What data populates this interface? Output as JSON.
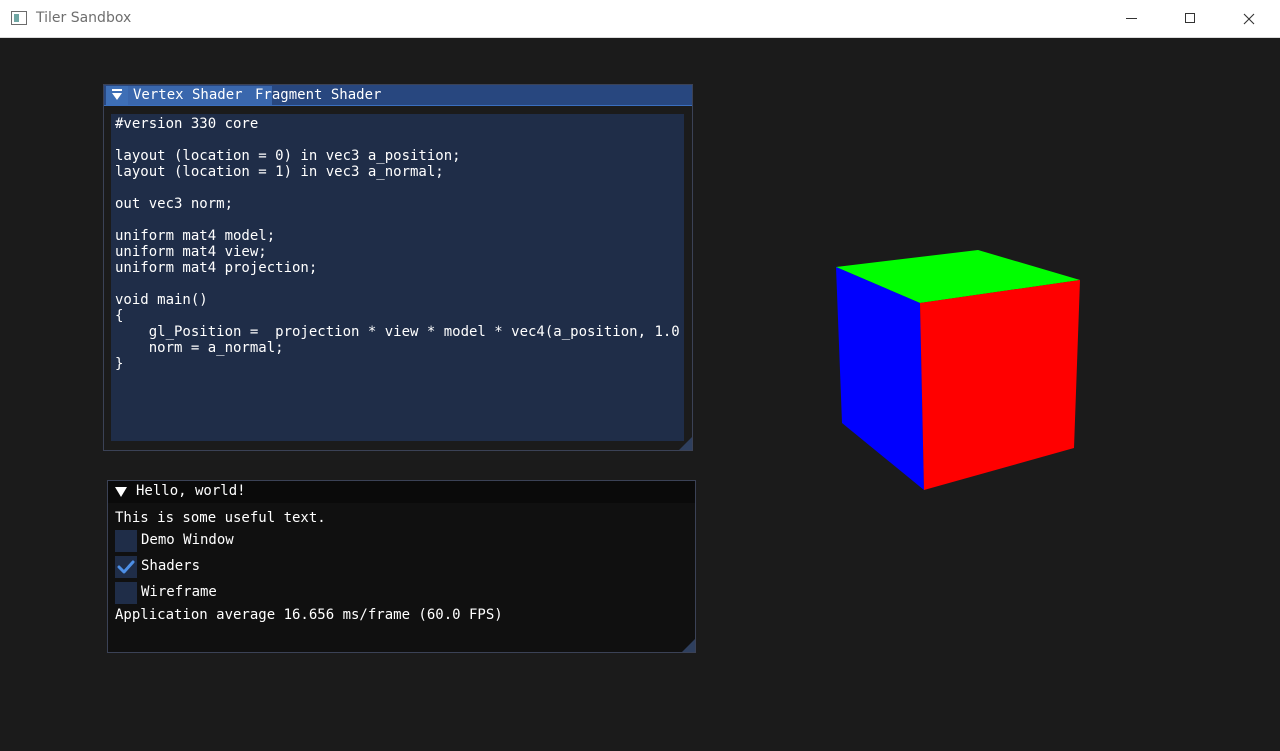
{
  "window": {
    "title": "Tiler Sandbox"
  },
  "shader_editor": {
    "tabs": [
      {
        "label": "Vertex Shader",
        "active": true
      },
      {
        "label": "Fragment Shader",
        "active": false
      }
    ],
    "code": "#version 330 core\n\nlayout (location = 0) in vec3 a_position;\nlayout (location = 1) in vec3 a_normal;\n\nout vec3 norm;\n\nuniform mat4 model;\nuniform mat4 view;\nuniform mat4 projection;\n\nvoid main()\n{\n    gl_Position =  projection * view * model * vec4(a_position, 1.0\n    norm = a_normal;\n}"
  },
  "hello_window": {
    "title": "Hello, world!",
    "text": "This is some useful text.",
    "checkboxes": [
      {
        "label": "Demo Window",
        "checked": false
      },
      {
        "label": "Shaders",
        "checked": true
      },
      {
        "label": "Wireframe",
        "checked": false
      }
    ],
    "fps_text": "Application average 16.656 ms/frame (60.0 FPS)"
  },
  "colors": {
    "cube_top": "#00ff00",
    "cube_left": "#0000ff",
    "cube_right": "#ff0000",
    "accent": "#3a67ad"
  }
}
